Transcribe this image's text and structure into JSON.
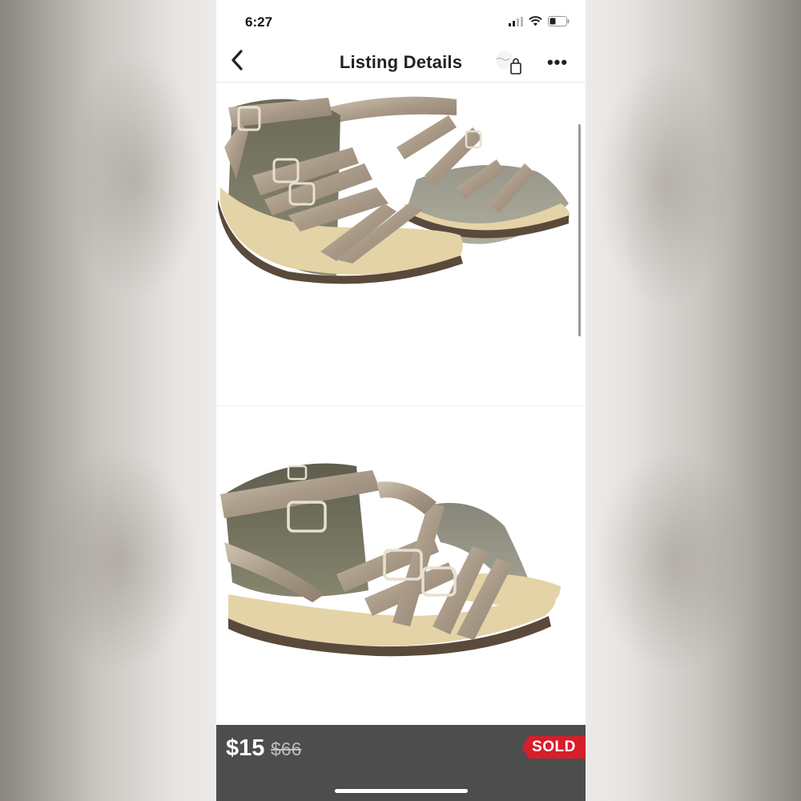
{
  "status_bar": {
    "time": "6:27"
  },
  "nav": {
    "title": "Listing Details",
    "back_icon": "chevron-left-icon",
    "shop_icon": "shopping-bag-icon",
    "more_label": "•••"
  },
  "photos": [
    {
      "subject": "metallic gladiator sandals, angled front view"
    },
    {
      "subject": "metallic gladiator sandals, side view"
    }
  ],
  "listing": {
    "price": "$15",
    "original_price": "$66",
    "status_badge": "SOLD"
  },
  "colors": {
    "price_bar": "#4d4d4d",
    "sold_badge": "#d71e2b",
    "sandal_metallic": "#b8aa97",
    "sole": "#e4d3a6"
  }
}
